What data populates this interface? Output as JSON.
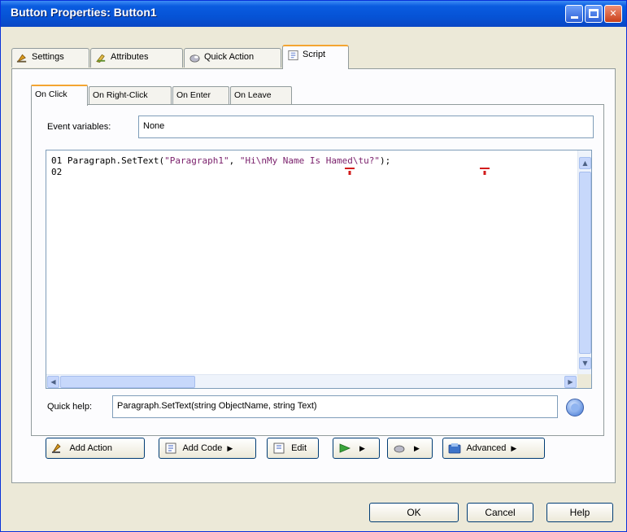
{
  "window": {
    "title": "Button Properties: Button1"
  },
  "main_tabs": [
    {
      "label": "Settings",
      "icon": "settings-icon"
    },
    {
      "label": "Attributes",
      "icon": "attributes-icon"
    },
    {
      "label": "Quick Action",
      "icon": "quick-action-icon"
    },
    {
      "label": "Script",
      "icon": "script-icon",
      "active": true
    }
  ],
  "event_tabs": [
    {
      "label": "On Click",
      "active": true
    },
    {
      "label": "On Right-Click"
    },
    {
      "label": "On Enter"
    },
    {
      "label": "On Leave"
    }
  ],
  "event_variables": {
    "label": "Event variables:",
    "value": "None"
  },
  "script": {
    "line1_num": "01",
    "line1_code_pre": "Paragraph.SetText(",
    "line1_str1": "\"Paragraph1\"",
    "line1_code_mid": ", ",
    "line1_str2": "\"Hi\\nMy Name Is Hamed\\tu?\"",
    "line1_code_post": ");",
    "line2_num": "02"
  },
  "quick_help": {
    "label": "Quick help:",
    "value": "Paragraph.SetText(string ObjectName, string Text)"
  },
  "toolbar": {
    "add_action": "Add Action",
    "add_code": "Add Code",
    "edit": "Edit",
    "advanced": "Advanced"
  },
  "dialog_buttons": {
    "ok": "OK",
    "cancel": "Cancel",
    "help": "Help"
  },
  "colors": {
    "title_bar": "#0653d6",
    "string_literal": "#7a1f6b",
    "active_tab_accent": "#f4a531"
  }
}
